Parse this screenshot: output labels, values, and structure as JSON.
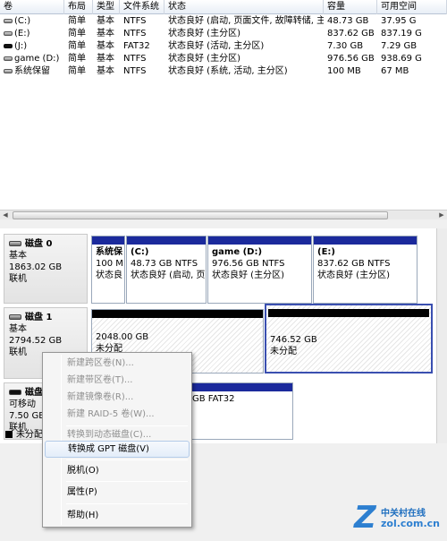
{
  "columns": [
    "卷",
    "布局",
    "类型",
    "文件系统",
    "状态",
    "容量",
    "可用空间"
  ],
  "volumes": [
    {
      "name": "(C:)",
      "layout": "简单",
      "type": "基本",
      "fs": "NTFS",
      "status": "状态良好 (启动, 页面文件, 故障转储, 主分区)",
      "capacity": "48.73 GB",
      "free": "37.95 G",
      "icon": "volume-icon"
    },
    {
      "name": "(E:)",
      "layout": "简单",
      "type": "基本",
      "fs": "NTFS",
      "status": "状态良好 (主分区)",
      "capacity": "837.62 GB",
      "free": "837.19 G",
      "icon": "volume-icon"
    },
    {
      "name": "(J:)",
      "layout": "简单",
      "type": "基本",
      "fs": "FAT32",
      "status": "状态良好 (活动, 主分区)",
      "capacity": "7.30 GB",
      "free": "7.29 GB",
      "icon": "removable-volume-icon"
    },
    {
      "name": "game (D:)",
      "layout": "简单",
      "type": "基本",
      "fs": "NTFS",
      "status": "状态良好 (主分区)",
      "capacity": "976.56 GB",
      "free": "938.69 G",
      "icon": "volume-icon"
    },
    {
      "name": "系统保留",
      "layout": "简单",
      "type": "基本",
      "fs": "NTFS",
      "status": "状态良好 (系统, 活动, 主分区)",
      "capacity": "100 MB",
      "free": "67 MB",
      "icon": "volume-icon"
    }
  ],
  "disks": [
    {
      "title": "磁盘 0",
      "type": "基本",
      "size": "1863.02 GB",
      "state": "联机",
      "partitions": [
        {
          "name": "系统保",
          "line2": "100 M",
          "line3": "状态良",
          "bar": "blue"
        },
        {
          "name": "(C:)",
          "line2": "48.73 GB NTFS",
          "line3": "状态良好 (启动, 页",
          "bar": "blue"
        },
        {
          "name": "game  (D:)",
          "line2": "976.56 GB NTFS",
          "line3": "状态良好 (主分区)",
          "bar": "blue"
        },
        {
          "name": "(E:)",
          "line2": "837.62 GB NTFS",
          "line3": "状态良好 (主分区)",
          "bar": "blue"
        }
      ]
    },
    {
      "title": "磁盘 1",
      "type": "基本",
      "size": "2794.52 GB",
      "state": "联机",
      "partitions": [
        {
          "name": "",
          "line2": "2048.00 GB",
          "line3": "未分配",
          "bar": "black"
        },
        {
          "name": "",
          "line2": "746.52 GB",
          "line3": "未分配",
          "bar": "black"
        }
      ]
    },
    {
      "title": "磁盘",
      "type": "可移动",
      "size": "7.50 GB",
      "state": "联机",
      "partitions": [
        {
          "name": "",
          "line2": "GB FAT32",
          "line3": "",
          "bar": "blue"
        }
      ]
    }
  ],
  "legend": {
    "unallocated": "未分配"
  },
  "context_menu": [
    {
      "label": "新建跨区卷(N)...",
      "enabled": false
    },
    {
      "label": "新建带区卷(T)...",
      "enabled": false
    },
    {
      "label": "新建镜像卷(R)...",
      "enabled": false
    },
    {
      "label": "新建 RAID-5 卷(W)...",
      "enabled": false
    },
    {
      "sep": true
    },
    {
      "label": "转换到动态磁盘(C)...",
      "enabled": false
    },
    {
      "label": "转换成 GPT 磁盘(V)",
      "enabled": true,
      "hover": true
    },
    {
      "sep": true
    },
    {
      "label": "脱机(O)",
      "enabled": true
    },
    {
      "sep": true
    },
    {
      "label": "属性(P)",
      "enabled": true
    },
    {
      "sep": true
    },
    {
      "label": "帮助(H)",
      "enabled": true
    }
  ],
  "logo": {
    "cn": "中关村在线",
    "en": "zol.com.cn",
    "mark": "Z"
  },
  "colors": {
    "partition_bar": "#1b2a9c",
    "unallocated_bar": "#000000",
    "selection": "#3a4fb0"
  }
}
